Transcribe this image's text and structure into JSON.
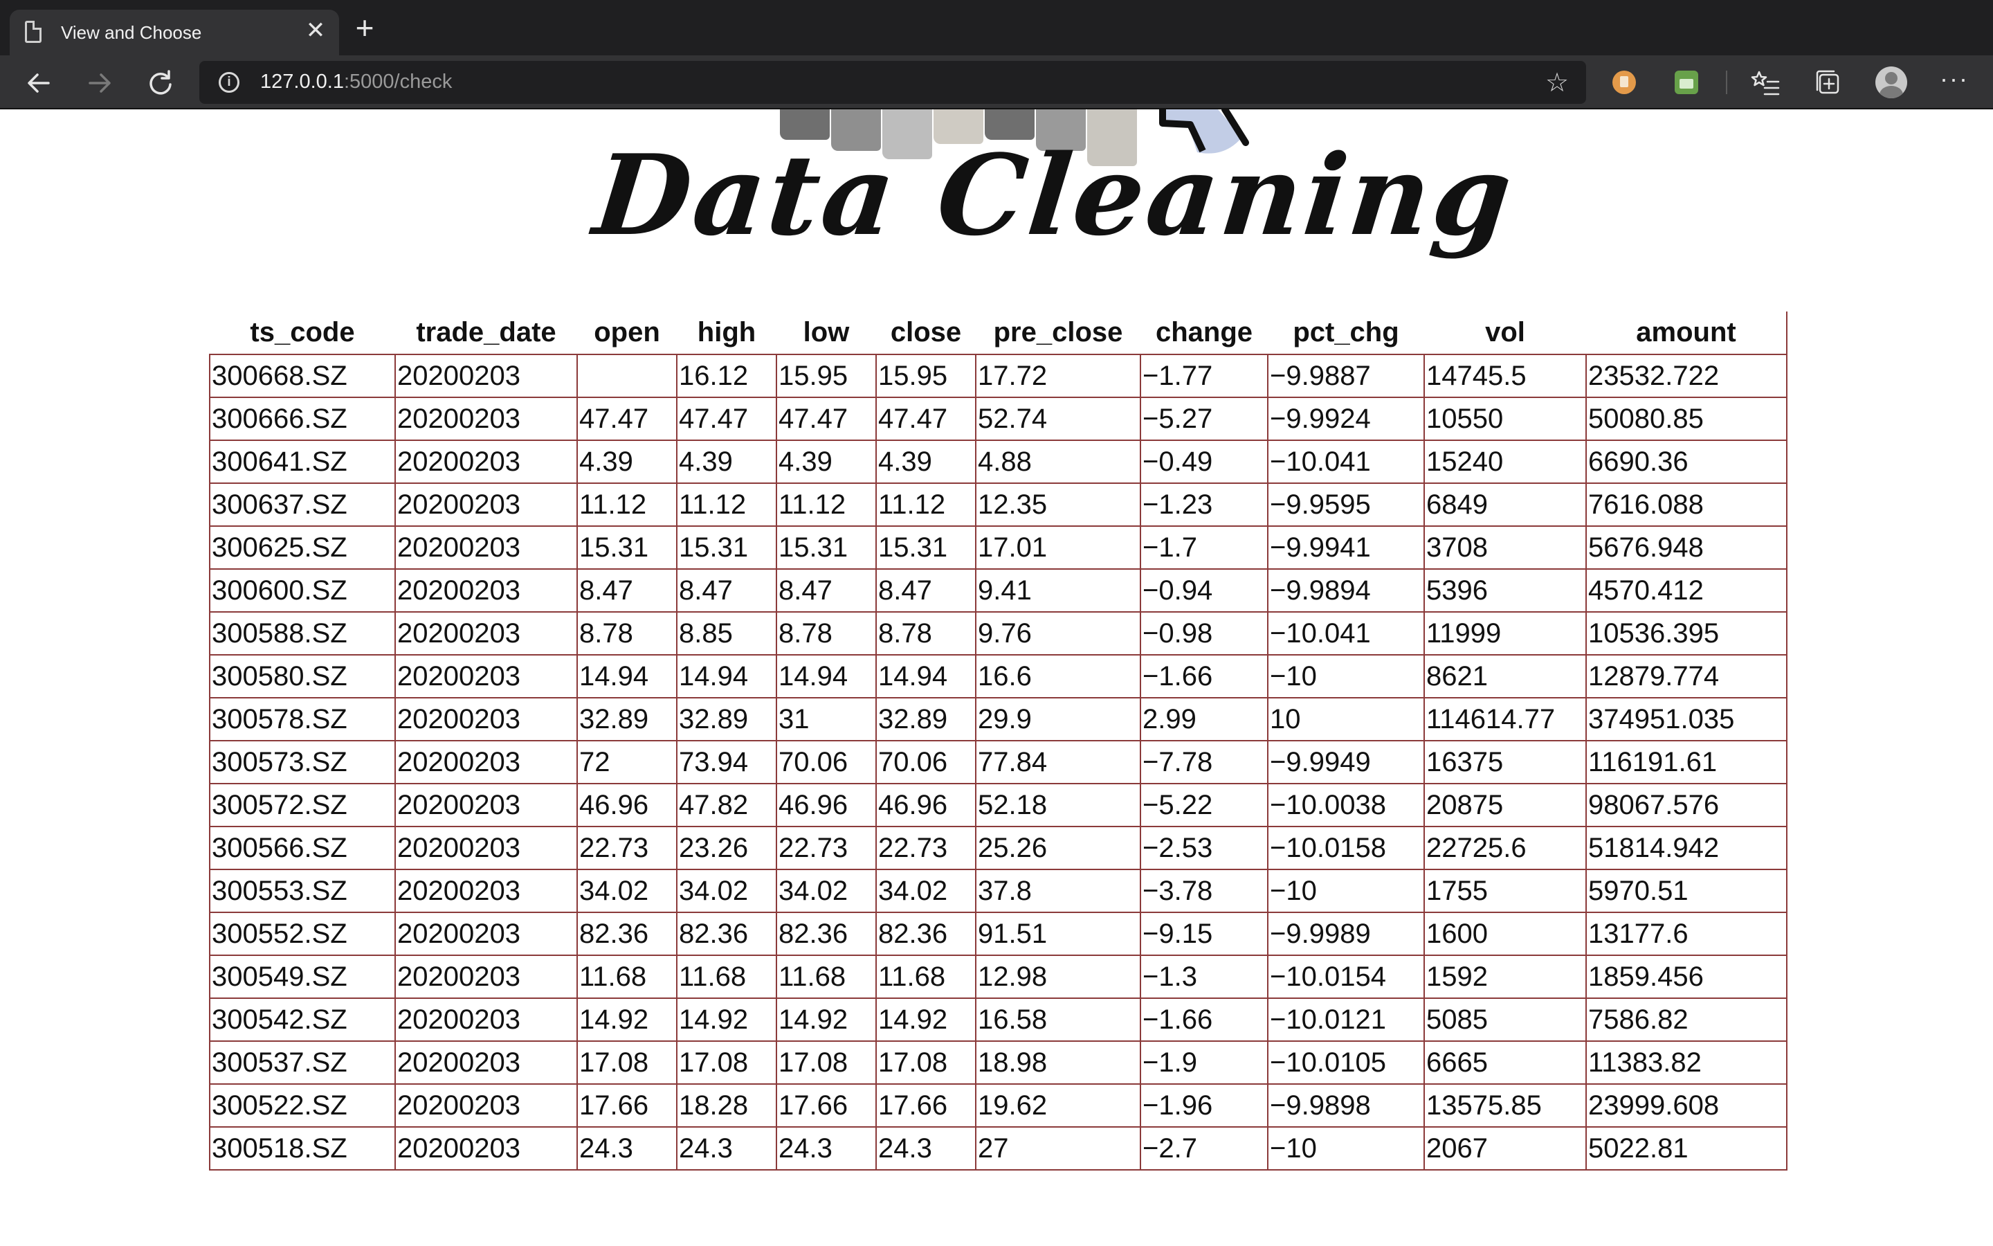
{
  "browser": {
    "tab_title": "View and Choose",
    "tab_close_glyph": "✕",
    "new_tab_glyph": "+",
    "url_host": "127.0.0.1",
    "url_path": ":5000/check"
  },
  "page": {
    "logo_text": "Data Cleaning"
  },
  "table": {
    "headers": [
      "ts_code",
      "trade_date",
      "open",
      "high",
      "low",
      "close",
      "pre_close",
      "change",
      "pct_chg",
      "vol",
      "amount"
    ],
    "rows": [
      [
        "300668.SZ",
        "20200203",
        "",
        "16.12",
        "15.95",
        "15.95",
        "17.72",
        "−1.77",
        "−9.9887",
        "14745.5",
        "23532.722"
      ],
      [
        "300666.SZ",
        "20200203",
        "47.47",
        "47.47",
        "47.47",
        "47.47",
        "52.74",
        "−5.27",
        "−9.9924",
        "10550",
        "50080.85"
      ],
      [
        "300641.SZ",
        "20200203",
        "4.39",
        "4.39",
        "4.39",
        "4.39",
        "4.88",
        "−0.49",
        "−10.041",
        "15240",
        "6690.36"
      ],
      [
        "300637.SZ",
        "20200203",
        "11.12",
        "11.12",
        "11.12",
        "11.12",
        "12.35",
        "−1.23",
        "−9.9595",
        "6849",
        "7616.088"
      ],
      [
        "300625.SZ",
        "20200203",
        "15.31",
        "15.31",
        "15.31",
        "15.31",
        "17.01",
        "−1.7",
        "−9.9941",
        "3708",
        "5676.948"
      ],
      [
        "300600.SZ",
        "20200203",
        "8.47",
        "8.47",
        "8.47",
        "8.47",
        "9.41",
        "−0.94",
        "−9.9894",
        "5396",
        "4570.412"
      ],
      [
        "300588.SZ",
        "20200203",
        "8.78",
        "8.85",
        "8.78",
        "8.78",
        "9.76",
        "−0.98",
        "−10.041",
        "11999",
        "10536.395"
      ],
      [
        "300580.SZ",
        "20200203",
        "14.94",
        "14.94",
        "14.94",
        "14.94",
        "16.6",
        "−1.66",
        "−10",
        "8621",
        "12879.774"
      ],
      [
        "300578.SZ",
        "20200203",
        "32.89",
        "32.89",
        "31",
        "32.89",
        "29.9",
        "2.99",
        "10",
        "114614.77",
        "374951.035"
      ],
      [
        "300573.SZ",
        "20200203",
        "72",
        "73.94",
        "70.06",
        "70.06",
        "77.84",
        "−7.78",
        "−9.9949",
        "16375",
        "116191.61"
      ],
      [
        "300572.SZ",
        "20200203",
        "46.96",
        "47.82",
        "46.96",
        "46.96",
        "52.18",
        "−5.22",
        "−10.0038",
        "20875",
        "98067.576"
      ],
      [
        "300566.SZ",
        "20200203",
        "22.73",
        "23.26",
        "22.73",
        "22.73",
        "25.26",
        "−2.53",
        "−10.0158",
        "22725.6",
        "51814.942"
      ],
      [
        "300553.SZ",
        "20200203",
        "34.02",
        "34.02",
        "34.02",
        "34.02",
        "37.8",
        "−3.78",
        "−10",
        "1755",
        "5970.51"
      ],
      [
        "300552.SZ",
        "20200203",
        "82.36",
        "82.36",
        "82.36",
        "82.36",
        "91.51",
        "−9.15",
        "−9.9989",
        "1600",
        "13177.6"
      ],
      [
        "300549.SZ",
        "20200203",
        "11.68",
        "11.68",
        "11.68",
        "11.68",
        "12.98",
        "−1.3",
        "−10.0154",
        "1592",
        "1859.456"
      ],
      [
        "300542.SZ",
        "20200203",
        "14.92",
        "14.92",
        "14.92",
        "14.92",
        "16.58",
        "−1.66",
        "−10.0121",
        "5085",
        "7586.82"
      ],
      [
        "300537.SZ",
        "20200203",
        "17.08",
        "17.08",
        "17.08",
        "17.08",
        "18.98",
        "−1.9",
        "−10.0105",
        "6665",
        "11383.82"
      ],
      [
        "300522.SZ",
        "20200203",
        "17.66",
        "18.28",
        "17.66",
        "17.66",
        "19.62",
        "−1.96",
        "−9.9898",
        "13575.85",
        "23999.608"
      ],
      [
        "300518.SZ",
        "20200203",
        "24.3",
        "24.3",
        "24.3",
        "24.3",
        "27",
        "−2.7",
        "−10",
        "2067",
        "5022.81"
      ]
    ]
  },
  "colors": {
    "table_border": "#8b3a3a",
    "tab_bar": "#1f1f21",
    "toolbar": "#333335"
  }
}
